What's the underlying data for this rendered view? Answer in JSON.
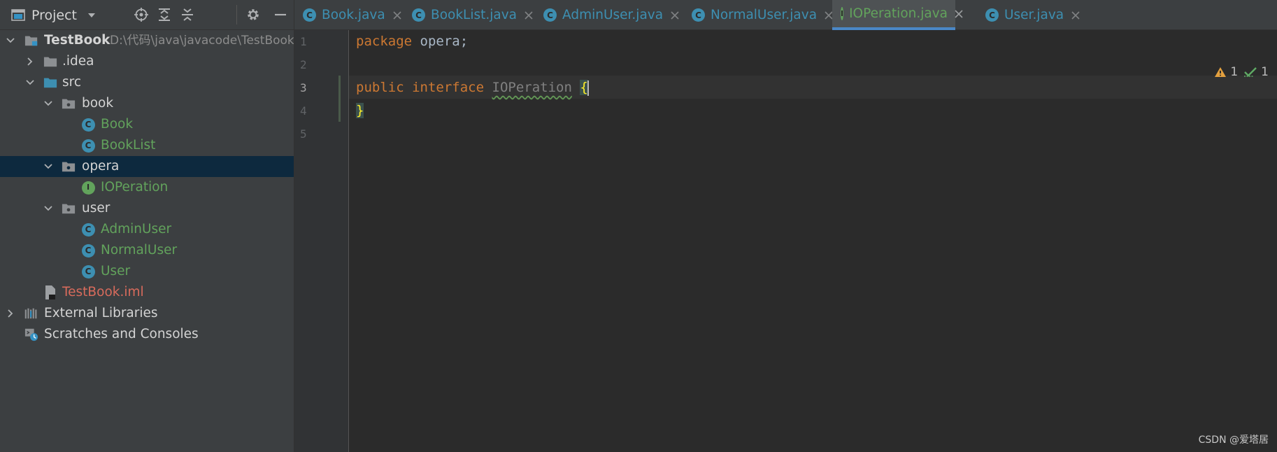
{
  "project_panel": {
    "title": "Project",
    "header_icons": [
      "locate-icon",
      "expand-all-icon",
      "collapse-all-icon",
      "gear-icon",
      "minimize-icon"
    ]
  },
  "tree": {
    "root": {
      "name": "TestBook",
      "path": "D:\\代码\\java\\javacode\\TestBook"
    },
    "idea": ".idea",
    "src": "src",
    "book": "book",
    "book_class": "Book",
    "booklist_class": "BookList",
    "opera": "opera",
    "ioperation": "IOPeration",
    "user": "user",
    "adminuser_class": "AdminUser",
    "normaluser_class": "NormalUser",
    "user_class": "User",
    "iml": "TestBook.iml",
    "external_libraries": "External Libraries",
    "scratches": "Scratches and Consoles"
  },
  "tabs": [
    {
      "label": "Book.java",
      "kind": "class"
    },
    {
      "label": "BookList.java",
      "kind": "class"
    },
    {
      "label": "AdminUser.java",
      "kind": "class"
    },
    {
      "label": "NormalUser.java",
      "kind": "class"
    },
    {
      "label": "IOPeration.java",
      "kind": "interface",
      "active": true
    },
    {
      "label": "User.java",
      "kind": "class"
    }
  ],
  "icon_letters": {
    "class": "C",
    "interface": "I"
  },
  "editor": {
    "line_numbers": [
      "1",
      "2",
      "3",
      "4",
      "5"
    ],
    "current_line": "3",
    "code": {
      "l1_kw": "package",
      "l1_rest": " opera;",
      "l3_kw1": "public",
      "l3_kw2": "interface",
      "l3_name": "IOPeration",
      "l3_brace": "{",
      "l4_brace": "}"
    },
    "inspections": {
      "warnings": "1",
      "weak_warnings": "1"
    }
  },
  "colors": {
    "accent": "#4a88c7",
    "class_icon": "#3d8fb1",
    "interface_icon": "#62a35c",
    "keyword": "#cc7832",
    "selection": "#0d293e"
  },
  "watermark": "CSDN @爱塔居"
}
